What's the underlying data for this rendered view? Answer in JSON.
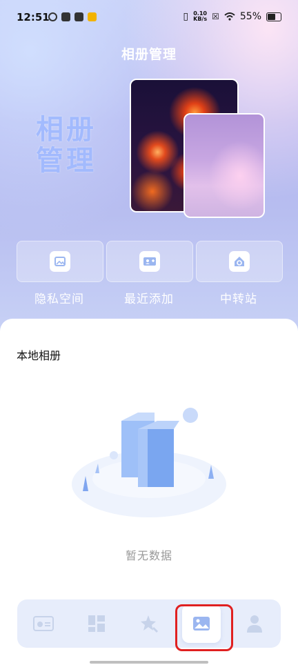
{
  "status_bar": {
    "time": "12:51",
    "speed_value": "0.10",
    "speed_unit": "KB/s",
    "battery": "55%"
  },
  "header": {
    "title": "相册管理",
    "hero_text_line1": "相册",
    "hero_text_line2": "管理"
  },
  "quick_actions": [
    {
      "label": "隐私空间",
      "icon": "image-icon"
    },
    {
      "label": "最近添加",
      "icon": "add-person-icon"
    },
    {
      "label": "中转站",
      "icon": "transfer-home-icon"
    }
  ],
  "section": {
    "title": "本地相册",
    "empty_text": "暂无数据"
  },
  "tabbar": {
    "items": [
      {
        "name": "card-icon",
        "active": false
      },
      {
        "name": "dashboard-icon",
        "active": false
      },
      {
        "name": "magic-star-icon",
        "active": false
      },
      {
        "name": "gallery-icon",
        "active": true
      },
      {
        "name": "profile-icon",
        "active": false
      }
    ]
  },
  "colors": {
    "accent": "#9bb6f0",
    "highlight": "#e02020",
    "tabbar_bg": "#e7edfb"
  }
}
